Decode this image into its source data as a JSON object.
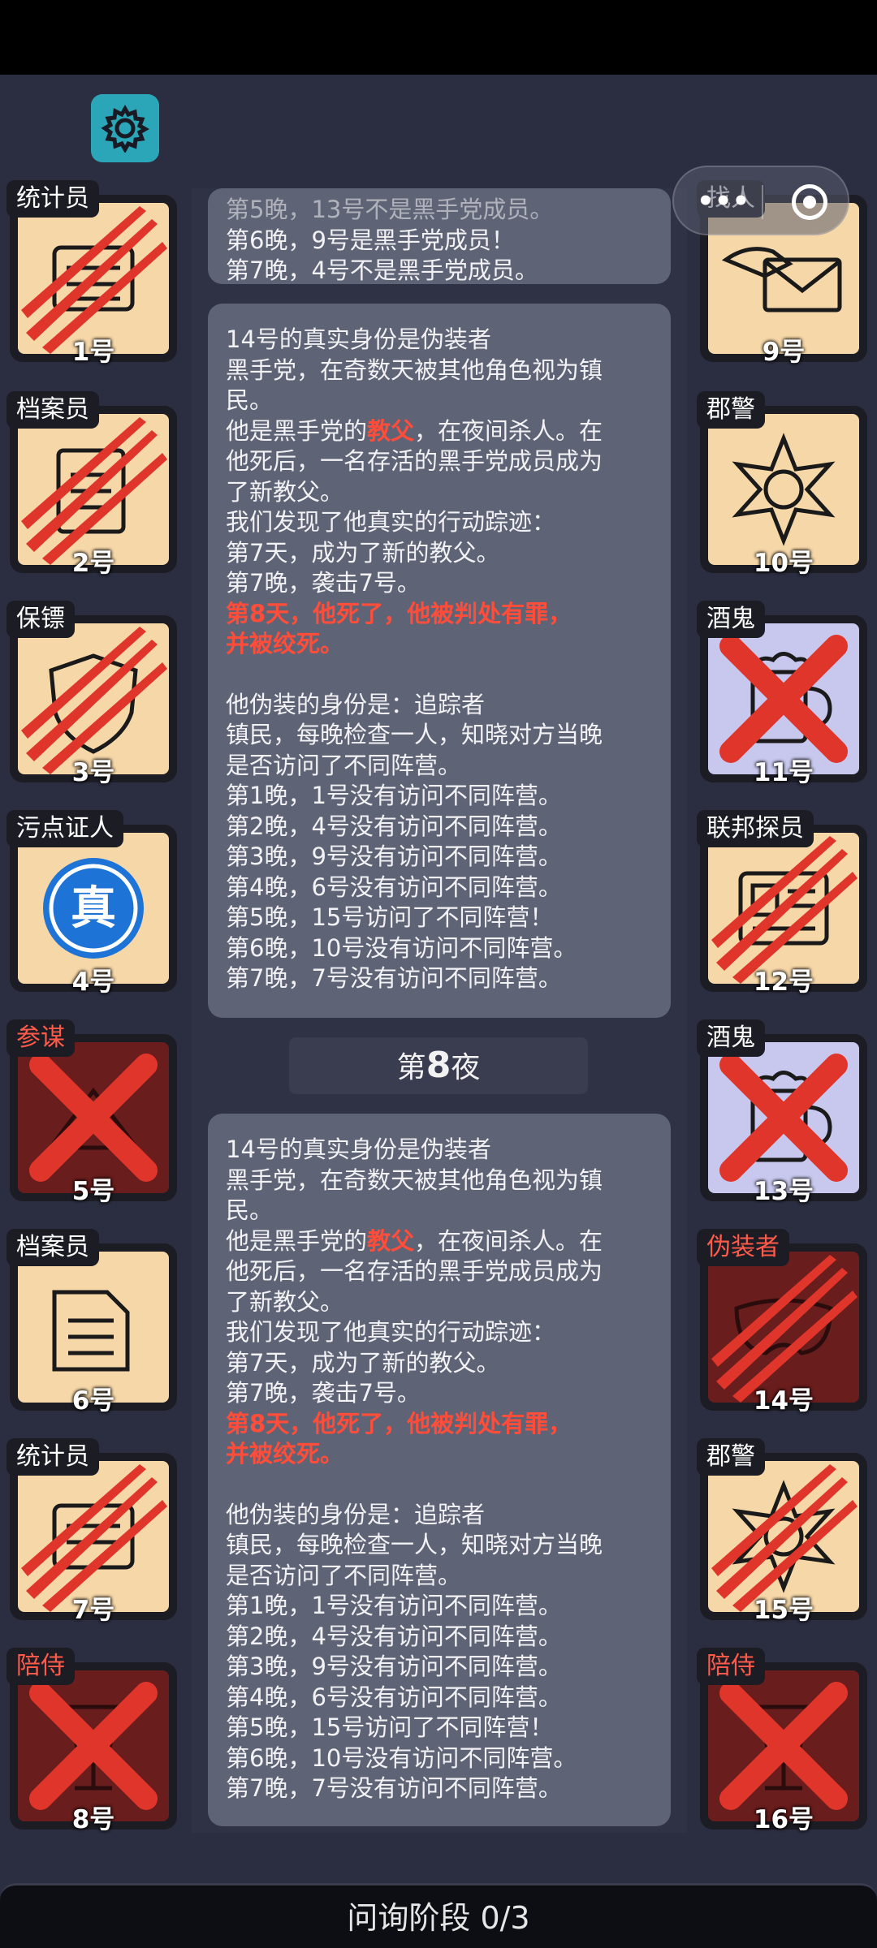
{
  "settings_icon": "gear-icon",
  "capsule": {
    "dots": "•••",
    "menu_icon": "more-dots-icon",
    "target_icon": "target-icon"
  },
  "overlap_text": "找人",
  "top_panel": {
    "line_faded": "第5晚，13号不是黑手党成员。",
    "line1": "第6晚，9号是黑手党成员！",
    "line2": "第7晚，4号不是黑手党成员。"
  },
  "night_label": {
    "prefix": "第",
    "number": "8",
    "suffix": "夜"
  },
  "report": {
    "l1": "14号的真实身份是伪装者",
    "l2": "黑手党，在奇数天被其他角色视为镇",
    "l3": "民。",
    "l4a": "他是黑手党的",
    "l4b": "教父",
    "l4c": "，在夜间杀人。在",
    "l5": "他死后，一名存活的黑手党成员成为",
    "l6": "了新教父。",
    "l7": "我们发现了他真实的行动踪迹：",
    "l8": "第7天，成为了新的教父。",
    "l9": "第7晚，袭击7号。",
    "l10": "第8天，他死了，他被判处有罪，",
    "l11": "并被绞死。",
    "l12": "他伪装的身份是：追踪者",
    "l13": "镇民，每晚检查一人，知晓对方当晚",
    "l14": "是否访问了不同阵营。",
    "l15": "第1晚，1号没有访问不同阵营。",
    "l16": "第2晚，4号没有访问不同阵营。",
    "l17": "第3晚，9号没有访问不同阵营。",
    "l18": "第4晚，6号没有访问不同阵营。",
    "l19": "第5晚，15号访问了不同阵营！",
    "l20": "第6晚，10号没有访问不同阵营。",
    "l21": "第7晚，7号没有访问不同阵营。"
  },
  "players_left": [
    {
      "role": "统计员",
      "num": "1号",
      "icon": "calculator-icon",
      "state": "scratched"
    },
    {
      "role": "档案员",
      "num": "2号",
      "icon": "documents-icon",
      "state": "scratched"
    },
    {
      "role": "保镖",
      "num": "3号",
      "icon": "shield-icon",
      "state": "scratched"
    },
    {
      "role": "污点证人",
      "num": "4号",
      "icon": "truth-seal-icon",
      "state": "verified",
      "seal": "真"
    },
    {
      "role": "参谋",
      "num": "5号",
      "icon": "strategy-icon",
      "state": "dead"
    },
    {
      "role": "档案员",
      "num": "6号",
      "icon": "documents-icon",
      "state": "alive"
    },
    {
      "role": "统计员",
      "num": "7号",
      "icon": "calculator-icon",
      "state": "scratched"
    },
    {
      "role": "陪侍",
      "num": "8号",
      "icon": "wine-glass-icon",
      "state": "dead"
    }
  ],
  "players_right": [
    {
      "role": "找人",
      "num": "9号",
      "icon": "envelope-hand-icon",
      "state": "alive"
    },
    {
      "role": "郡警",
      "num": "10号",
      "icon": "sheriff-badge-icon",
      "state": "alive"
    },
    {
      "role": "酒鬼",
      "num": "11号",
      "icon": "beer-mug-icon",
      "state": "dead"
    },
    {
      "role": "联邦探员",
      "num": "12号",
      "icon": "id-card-icon",
      "state": "scratched"
    },
    {
      "role": "酒鬼",
      "num": "13号",
      "icon": "beer-mug-icon",
      "state": "dead"
    },
    {
      "role": "伪装者",
      "num": "14号",
      "icon": "mask-icon",
      "state": "scratched"
    },
    {
      "role": "郡警",
      "num": "15号",
      "icon": "sheriff-badge-icon",
      "state": "scratched"
    },
    {
      "role": "陪侍",
      "num": "16号",
      "icon": "wine-glass-icon",
      "state": "dead"
    }
  ],
  "phase": "问询阶段 0/3",
  "colors": {
    "accent_red": "#ff4d3a",
    "card_bg": "#f6d7a8",
    "dead_bg": "#6a1d1d",
    "settings": "#2aa6b8"
  }
}
